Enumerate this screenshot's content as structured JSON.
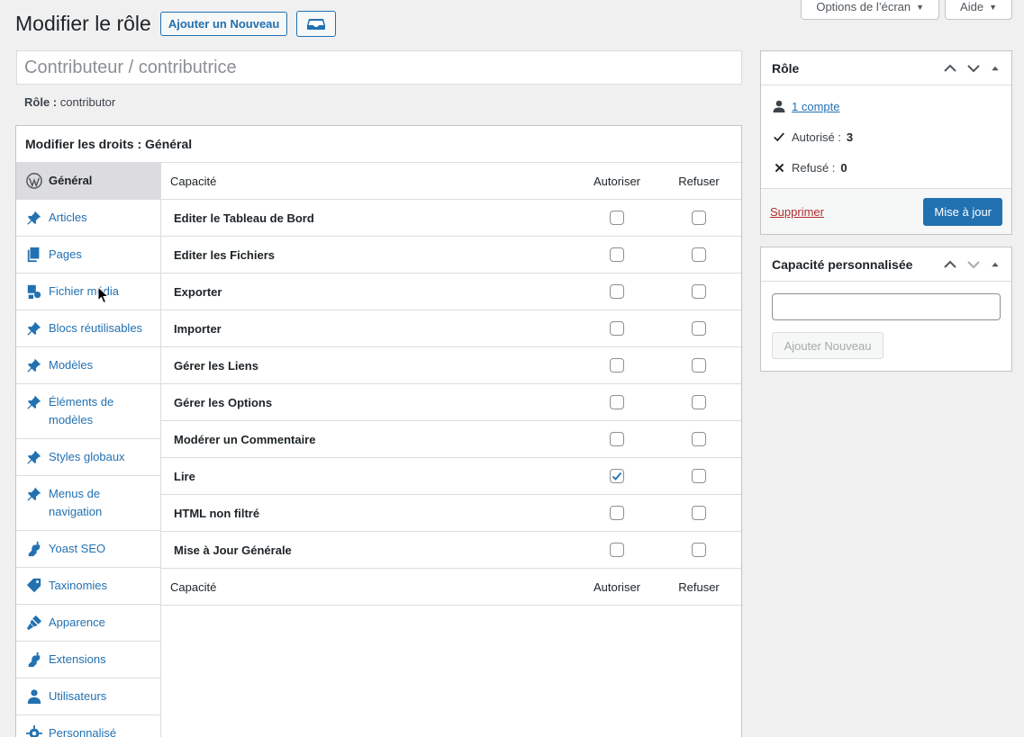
{
  "screen_meta": {
    "screen_options_label": "Options de l’écran",
    "help_label": "Aide"
  },
  "header": {
    "title": "Modifier le rôle",
    "add_new_label": "Ajouter un Nouveau"
  },
  "role": {
    "display_name": "Contributeur / contributrice",
    "slug_label": "Rôle :",
    "slug_value": "contributor"
  },
  "capabilities_box": {
    "title": "Modifier les droits : Général",
    "tabs": [
      {
        "label": "Général",
        "icon": "wordpress-icon",
        "active": true
      },
      {
        "label": "Articles",
        "icon": "pin-icon"
      },
      {
        "label": "Pages",
        "icon": "pages-icon"
      },
      {
        "label": "Fichier média",
        "icon": "media-icon"
      },
      {
        "label": "Blocs réutilisables",
        "icon": "pin-icon"
      },
      {
        "label": "Modèles",
        "icon": "pin-icon"
      },
      {
        "label": "Éléments de modèles",
        "icon": "pin-icon"
      },
      {
        "label": "Styles globaux",
        "icon": "pin-icon"
      },
      {
        "label": "Menus de navigation",
        "icon": "pin-icon"
      },
      {
        "label": "Yoast SEO",
        "icon": "plugin-icon"
      },
      {
        "label": "Taxinomies",
        "icon": "tag-icon"
      },
      {
        "label": "Apparence",
        "icon": "brush-icon"
      },
      {
        "label": "Extensions",
        "icon": "plugin-icon"
      },
      {
        "label": "Utilisateurs",
        "icon": "user-icon"
      },
      {
        "label": "Personnalisé",
        "icon": "gear-icon"
      }
    ],
    "columns": {
      "capability": "Capacité",
      "grant": "Autoriser",
      "deny": "Refuser"
    },
    "rows": [
      {
        "label": "Editer le Tableau de Bord",
        "grant": false,
        "deny": false
      },
      {
        "label": "Editer les Fichiers",
        "grant": false,
        "deny": false
      },
      {
        "label": "Exporter",
        "grant": false,
        "deny": false
      },
      {
        "label": "Importer",
        "grant": false,
        "deny": false
      },
      {
        "label": "Gérer les Liens",
        "grant": false,
        "deny": false
      },
      {
        "label": "Gérer les Options",
        "grant": false,
        "deny": false
      },
      {
        "label": "Modérer un Commentaire",
        "grant": false,
        "deny": false
      },
      {
        "label": "Lire",
        "grant": true,
        "deny": false
      },
      {
        "label": "HTML non filtré",
        "grant": false,
        "deny": false
      },
      {
        "label": "Mise à Jour Générale",
        "grant": false,
        "deny": false
      }
    ]
  },
  "role_box": {
    "title": "Rôle",
    "users_link": "1 compte",
    "granted_label": "Autorisé :",
    "granted_count": "3",
    "denied_label": "Refusé :",
    "denied_count": "0",
    "delete_label": "Supprimer",
    "update_label": "Mise à jour"
  },
  "custom_cap_box": {
    "title": "Capacité personnalisée",
    "input_value": "",
    "add_label": "Ajouter Nouveau"
  },
  "colors": {
    "accent": "#2271b1",
    "danger": "#b32d2e",
    "background": "#f0f0f1"
  }
}
